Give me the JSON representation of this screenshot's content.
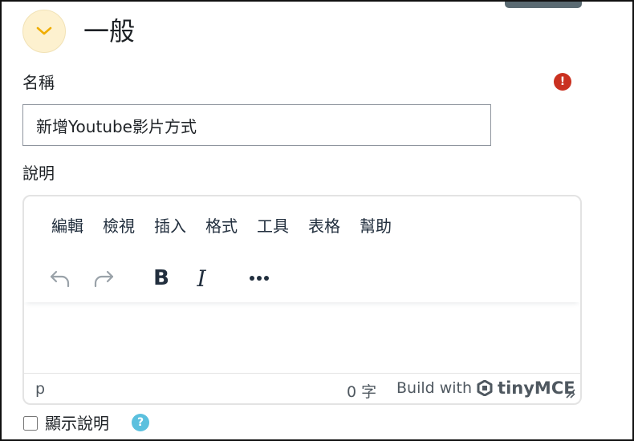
{
  "section": {
    "title": "一般",
    "toggle_icon": "chevron-down-icon"
  },
  "name_field": {
    "label": "名稱",
    "value": "新增Youtube影片方式",
    "required_icon": "exclamation-icon",
    "required_mark": "!"
  },
  "description_field": {
    "label": "說明"
  },
  "editor": {
    "menu": [
      "編輯",
      "檢視",
      "插入",
      "格式",
      "工具",
      "表格",
      "幫助"
    ],
    "toolbar": {
      "undo_icon": "undo-icon",
      "redo_icon": "redo-icon",
      "bold_label": "B",
      "italic_label": "I",
      "more_icon": "more-icon"
    },
    "status": {
      "path": "p",
      "word_count": "0 字",
      "build_with": "Build with",
      "brand": "tinyMCE"
    }
  },
  "show_description": {
    "label": "顯示說明",
    "checked": false,
    "help_mark": "?"
  },
  "colors": {
    "accent_toggle": "#fdf1cf",
    "chevron": "#f0ad00",
    "required": "#ca3120",
    "help": "#5bc0de"
  }
}
